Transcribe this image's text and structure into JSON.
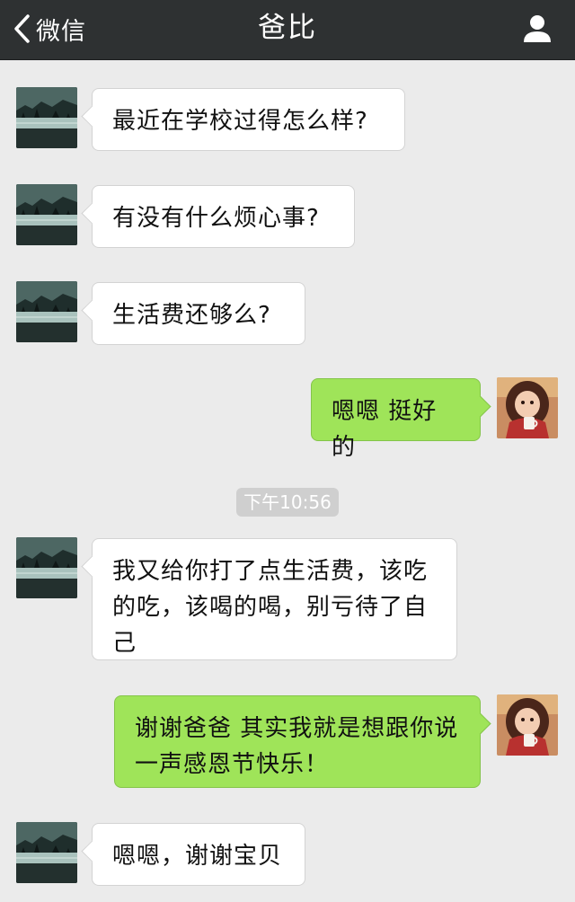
{
  "nav": {
    "back_label": "微信",
    "title": "爸比",
    "back_icon": "chevron-left-icon",
    "profile_icon": "user-icon"
  },
  "timestamp": "下午10:56",
  "messages": [
    {
      "from": "dad",
      "text": "最近在学校过得怎么样?"
    },
    {
      "from": "dad",
      "text": "有没有什么烦心事?"
    },
    {
      "from": "dad",
      "text": "生活费还够么?"
    },
    {
      "from": "me",
      "text": "嗯嗯 挺好的"
    },
    {
      "from": "dad",
      "text": "我又给你打了点生活费，该吃的吃，该喝的喝，别亏待了自己"
    },
    {
      "from": "me",
      "text": "谢谢爸爸 其实我就是想跟你说一声感恩节快乐！"
    },
    {
      "from": "dad",
      "text": "嗯嗯，谢谢宝贝"
    }
  ],
  "colors": {
    "nav_bg": "#2e3132",
    "chat_bg": "#ebebeb",
    "outgoing_bubble": "#9fe459",
    "incoming_bubble": "#ffffff"
  }
}
